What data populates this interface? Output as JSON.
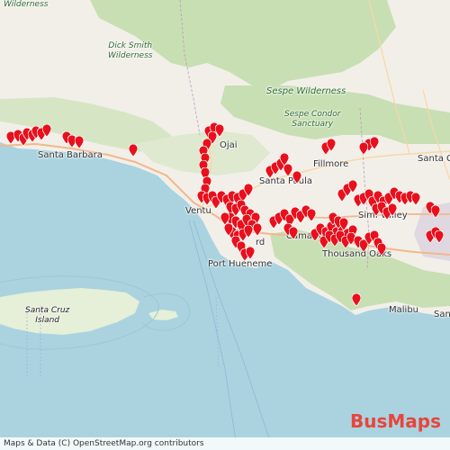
{
  "map": {
    "labels": {
      "santa_barbara": "Santa Barbara",
      "wilderness_top": "Wilderness",
      "dick_smith": "Dick Smith\nWilderness",
      "sespe_wilderness": "Sespe Wilderness",
      "sespe_condor": "Sespe Condor\nSanctuary",
      "fillmore": "Fillmore",
      "santa_clarita": "Santa C",
      "ojai": "Ojai",
      "santa_paula": "Santa Paula",
      "ventura": "Ventu",
      "camarillo": "Camarillo",
      "simi_valley": "Simi Valley",
      "thousand_oaks": "Thousand Oaks",
      "port_hueneme": "Port Hueneme",
      "malibu": "Malibu",
      "santa_m": "Santa",
      "santa_cruz_island": "Santa Cruz\nIsland",
      "oxnard": "rd"
    },
    "marker_color": "#e8101c",
    "land_color": "#f2efe9",
    "forest_color": "#c8dfb4",
    "water_color": "#aad3df"
  },
  "attribution": "Maps & Data (C) OpenStreetMap.org contributors",
  "brand": {
    "part1": "Bus",
    "part2": "Maps"
  }
}
